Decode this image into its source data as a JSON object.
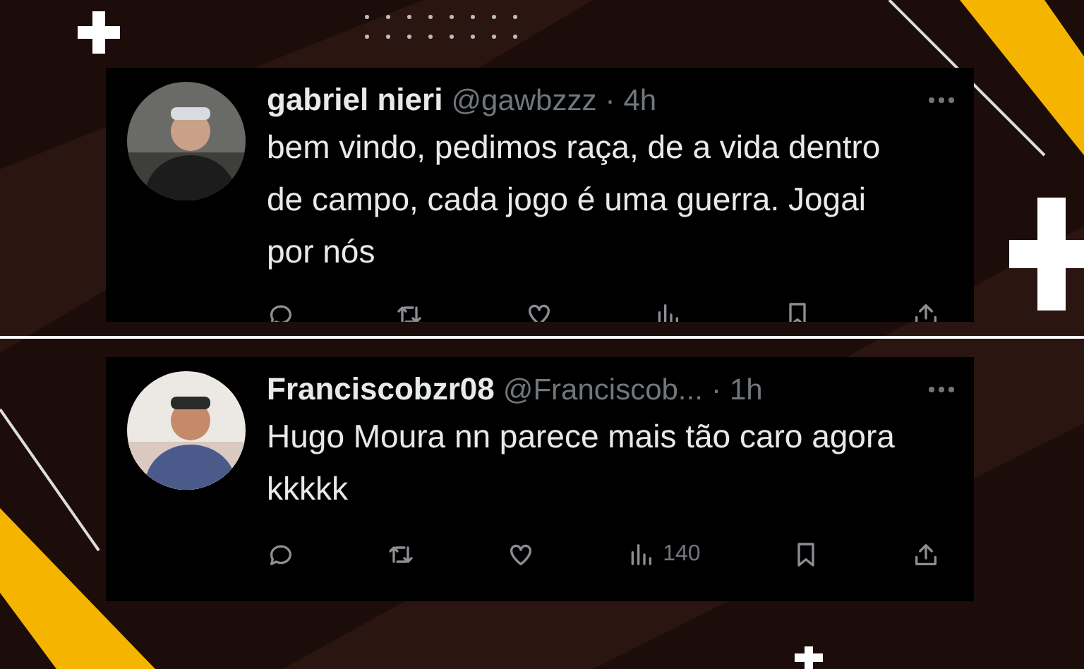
{
  "tweets": [
    {
      "display_name": "gabriel nieri",
      "handle": "@gawbzzz",
      "separator": "·",
      "time": "4h",
      "text": "bem vindo, pedimos raça, de a vida dentro de campo, cada jogo é uma guerra. Jogai por nós",
      "actions_cut": true
    },
    {
      "display_name": "Franciscobzr08",
      "handle": "@Franciscob...",
      "separator": "·",
      "time": "1h",
      "text": "Hugo Moura nn parece mais tão caro agora kkkkk",
      "views": "140",
      "actions_cut": false
    }
  ]
}
